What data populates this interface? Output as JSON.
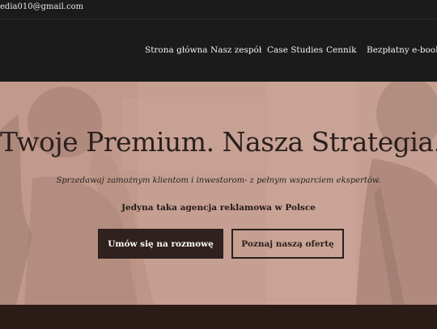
{
  "topbar": {
    "email": "edia010@gmail.com"
  },
  "nav": {
    "items": [
      {
        "label": "Strona główna"
      },
      {
        "label": "Nasz zespół"
      },
      {
        "label": "Case Studies"
      },
      {
        "label": "Cennik"
      },
      {
        "label": "Bezpłatny e-book"
      }
    ]
  },
  "hero": {
    "title": "Twoje Premium. Nasza Strategia.",
    "subtitle": "Sprzedawaj zamożnym klientom i inwestorom- z pełnym wsparciem ekspertów.",
    "tagline": "Jedyna taka agencja reklamowa w Polsce",
    "primary_button": "Umów się na rozmowę",
    "secondary_button": "Poznaj naszą ofertę"
  },
  "colors": {
    "header_bg": "#1b1b1b",
    "hero_overlay": "#c49d8f",
    "button_dark": "#2f211d",
    "bottom_strip": "#2b1c17"
  }
}
